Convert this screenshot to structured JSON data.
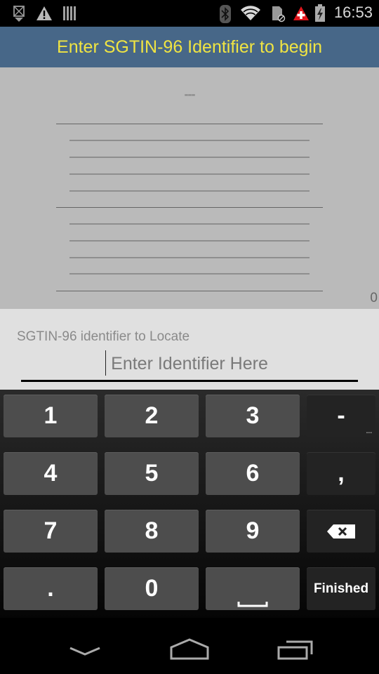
{
  "status_bar": {
    "left_icons": [
      "download-icon",
      "warning-icon",
      "barcode-icon"
    ],
    "right_icons": [
      "bluetooth-icon",
      "wifi-icon",
      "sd-card-icon",
      "medical-alert-icon",
      "battery-charging-icon"
    ],
    "time": "16:53"
  },
  "header": {
    "title": "Enter SGTIN-96 Identifier to begin"
  },
  "locator": {
    "placeholder_dashes": "---",
    "count": "0"
  },
  "identifier_input": {
    "label": "SGTIN-96 identifier to Locate",
    "placeholder": "Enter Identifier Here",
    "value": ""
  },
  "keyboard": {
    "rows": [
      [
        "1",
        "2",
        "3",
        "-"
      ],
      [
        "4",
        "5",
        "6",
        ","
      ],
      [
        "7",
        "8",
        "9",
        "backspace"
      ],
      [
        ".",
        "0",
        "space",
        "Finished"
      ]
    ],
    "minus_hint": "...",
    "done_label": "Finished"
  },
  "nav_bar": {
    "buttons": [
      "back-icon",
      "home-icon",
      "recents-icon"
    ]
  },
  "colors": {
    "header_bg": "#476788",
    "header_text": "#f0e442"
  }
}
